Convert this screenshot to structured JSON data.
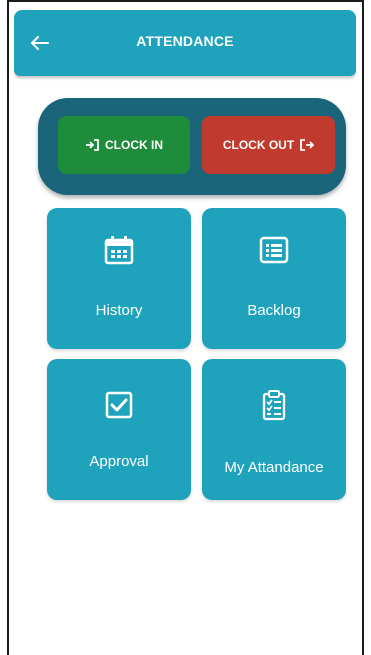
{
  "header": {
    "title": "ATTENDANCE",
    "back_icon": "arrow-left-icon"
  },
  "clock": {
    "in_label": "CLOCK IN",
    "in_icon": "sign-in-icon",
    "out_label": "CLOCK OUT",
    "out_icon": "sign-out-icon"
  },
  "tiles": [
    {
      "label": "History",
      "icon": "calendar-icon"
    },
    {
      "label": "Backlog",
      "icon": "list-icon"
    },
    {
      "label": "Approval",
      "icon": "checkbox-icon"
    },
    {
      "label": "My Attandance",
      "icon": "clipboard-checklist-icon"
    }
  ],
  "colors": {
    "primary": "#1fa3bc",
    "panel": "#1a6579",
    "clock_in": "#1f8c3b",
    "clock_out": "#c03a2d"
  }
}
